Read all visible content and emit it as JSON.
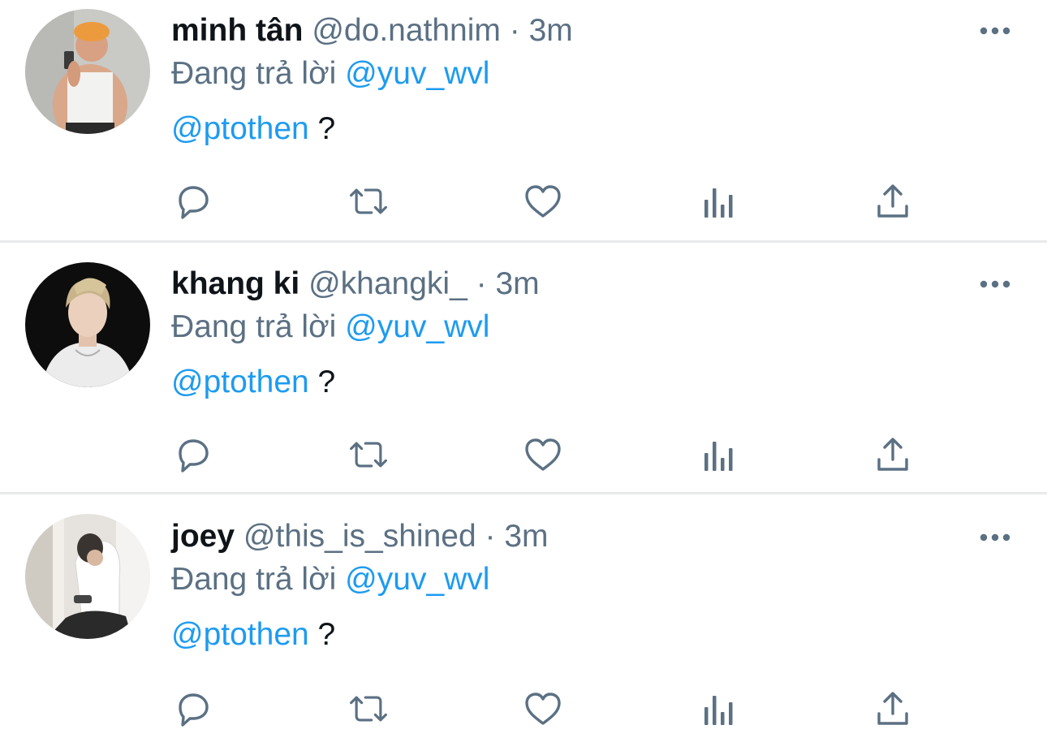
{
  "tweets": [
    {
      "name": "minh tân",
      "handle": "@do.nathnim",
      "separator": "·",
      "time": "3m",
      "reply_prefix": "Đang trả lời",
      "reply_to": "@yuv_wvl",
      "mention": "@ptothen",
      "text": " ?",
      "avatar": "avatar-orange-hair-selfie"
    },
    {
      "name": "khang ki",
      "handle": "@khangki_",
      "separator": "·",
      "time": "3m",
      "reply_prefix": "Đang trả lời",
      "reply_to": "@yuv_wvl",
      "mention": "@ptothen",
      "text": " ?",
      "avatar": "avatar-blond-portrait"
    },
    {
      "name": "joey",
      "handle": "@this_is_shined",
      "separator": "·",
      "time": "3m",
      "reply_prefix": "Đang trả lời",
      "reply_to": "@yuv_wvl",
      "mention": "@ptothen",
      "text": " ?",
      "avatar": "avatar-seated-person"
    }
  ],
  "actions": [
    "reply-icon",
    "retweet-icon",
    "like-icon",
    "analytics-icon",
    "share-icon"
  ],
  "more_icon": "more-dots-icon",
  "colors": {
    "accent": "#1d9bf0",
    "secondary_text": "#5b7083",
    "primary_text": "#0f1419",
    "divider": "#e8e9eb"
  }
}
